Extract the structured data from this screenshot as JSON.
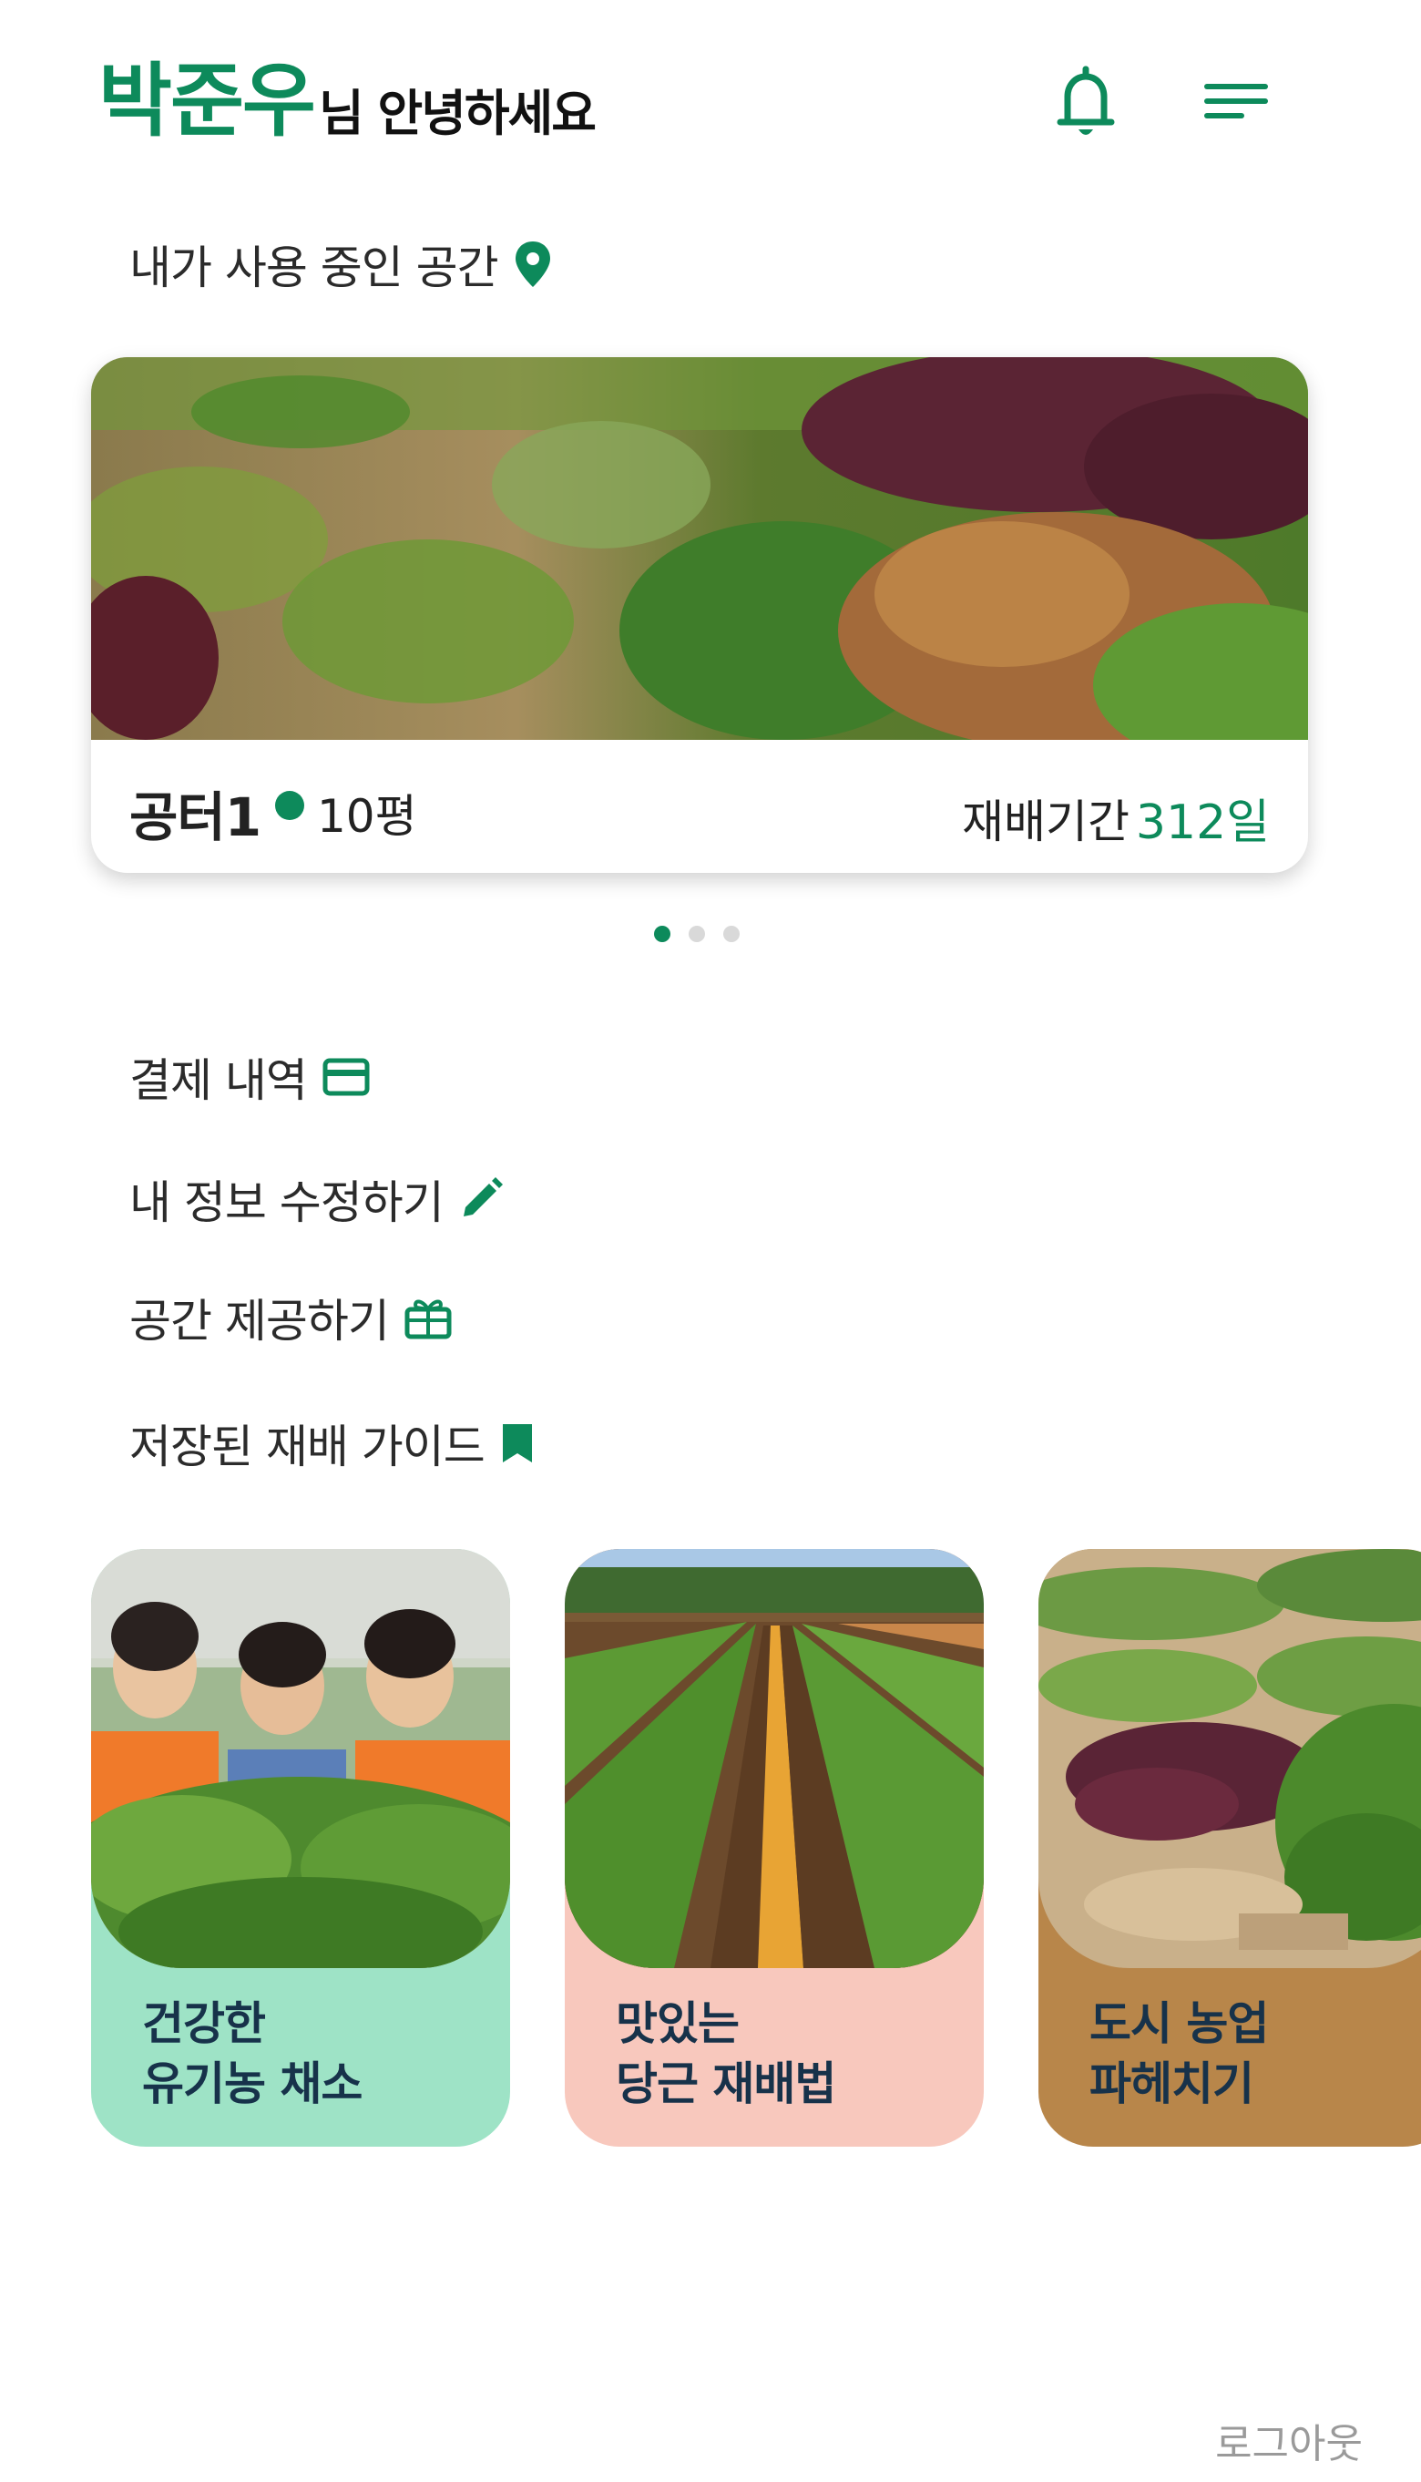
{
  "header": {
    "user_name": "박준우",
    "greeting": "님 안녕하세요",
    "icons": [
      "bell-icon",
      "menu-icon"
    ]
  },
  "spaces": {
    "section_label": "내가 사용 중인 공간",
    "section_icon": "location-pin-icon",
    "card": {
      "name": "공터1",
      "size": "10평",
      "period_label": "재배기간",
      "period_value": "312일"
    },
    "pager": {
      "total": 3,
      "active_index": 0
    }
  },
  "menu": {
    "payment": {
      "label": "결제 내역",
      "icon": "credit-card-icon"
    },
    "edit_profile": {
      "label": "내 정보 수정하기",
      "icon": "pencil-icon"
    },
    "provide_space": {
      "label": "공간 제공하기",
      "icon": "gift-icon"
    },
    "saved_guides": {
      "label": "저장된 재배 가이드",
      "icon": "bookmark-icon"
    }
  },
  "guides": [
    {
      "line1": "건강한",
      "line2": "유기농 채소",
      "bg": "#9ee3c6"
    },
    {
      "line1": "맛있는",
      "line2": "당근 재배법",
      "bg": "#f8c8bd"
    },
    {
      "line1": "도시 농업",
      "line2": "파헤치기",
      "bg": "#b8864a"
    }
  ],
  "footer": {
    "logout": "로그아웃"
  },
  "colors": {
    "accent": "#0d8a5b",
    "text": "#222222",
    "muted": "#9a9a9a"
  }
}
